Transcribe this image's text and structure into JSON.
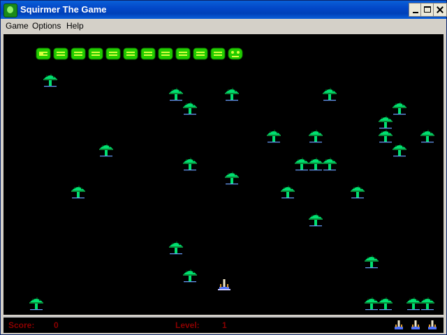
{
  "window": {
    "title": "Squirmer The Game"
  },
  "menu": {
    "game": "Game",
    "options": "Options",
    "help": "Help"
  },
  "status": {
    "score_label": "Score:",
    "score": "0",
    "level_label": "Level:",
    "level": "1"
  },
  "game": {
    "squirmer_segments": 12,
    "mushroom_count": 37,
    "lives_remaining": 3,
    "colors": {
      "background": "#000000",
      "squirmer": "#22cc00",
      "mushroom_cap": "#00e070",
      "status_text": "#8b0000"
    }
  }
}
